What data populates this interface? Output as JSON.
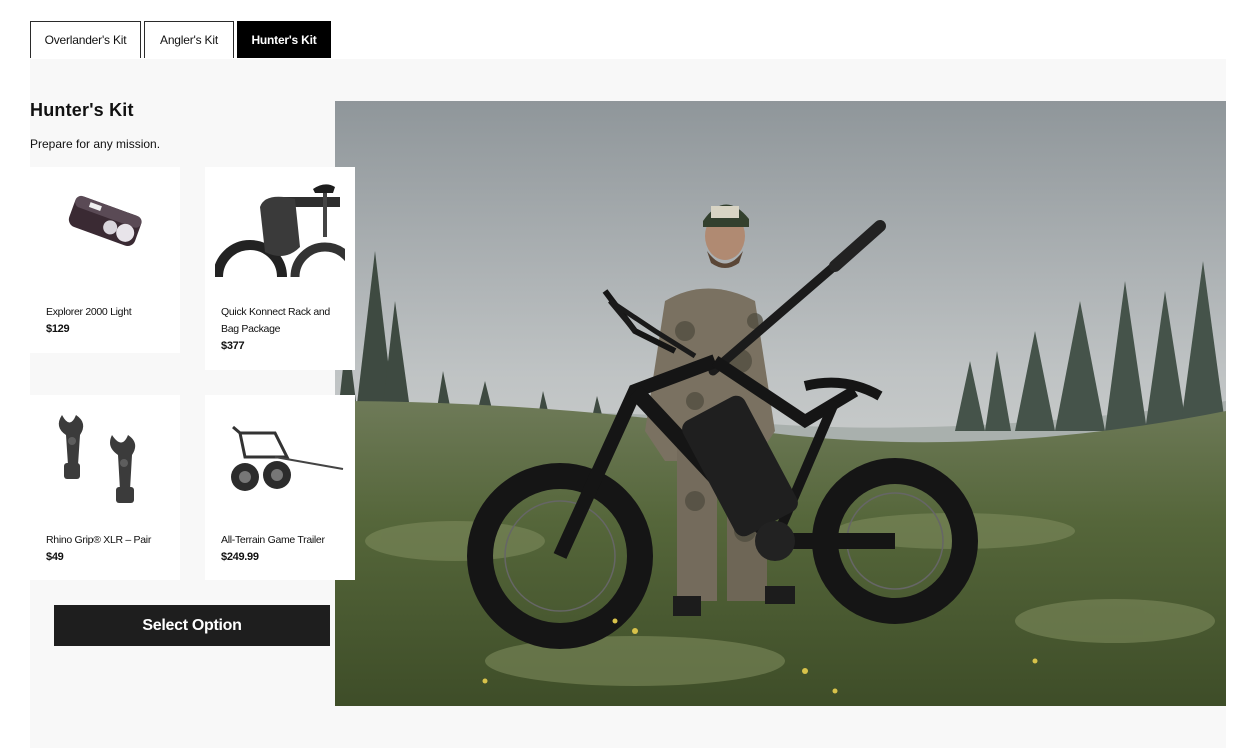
{
  "tabs": [
    {
      "label": "Overlander's Kit",
      "active": false
    },
    {
      "label": "Angler's Kit",
      "active": false
    },
    {
      "label": "Hunter's Kit",
      "active": true
    }
  ],
  "kit": {
    "title": "Hunter's Kit",
    "subtitle": "Prepare for any mission."
  },
  "products": [
    {
      "name": "Explorer 2000 Light",
      "price": "$129",
      "icon": "bike-light-icon"
    },
    {
      "name": "Quick Konnect Rack and Bag Package",
      "price": "$377",
      "icon": "rack-bag-icon"
    },
    {
      "name": "Rhino Grip® XLR – Pair",
      "price": "$49",
      "icon": "rhino-grip-icon"
    },
    {
      "name": "All-Terrain Game Trailer",
      "price": "$249.99",
      "icon": "game-trailer-icon"
    }
  ],
  "cta": {
    "label": "Select Option"
  },
  "hero": {
    "alt": "hunter-with-ebike-photo"
  },
  "colors": {
    "active_tab_bg": "#000000",
    "button_bg": "#1e1e1e",
    "panel_bg": "#f8f8f8"
  }
}
